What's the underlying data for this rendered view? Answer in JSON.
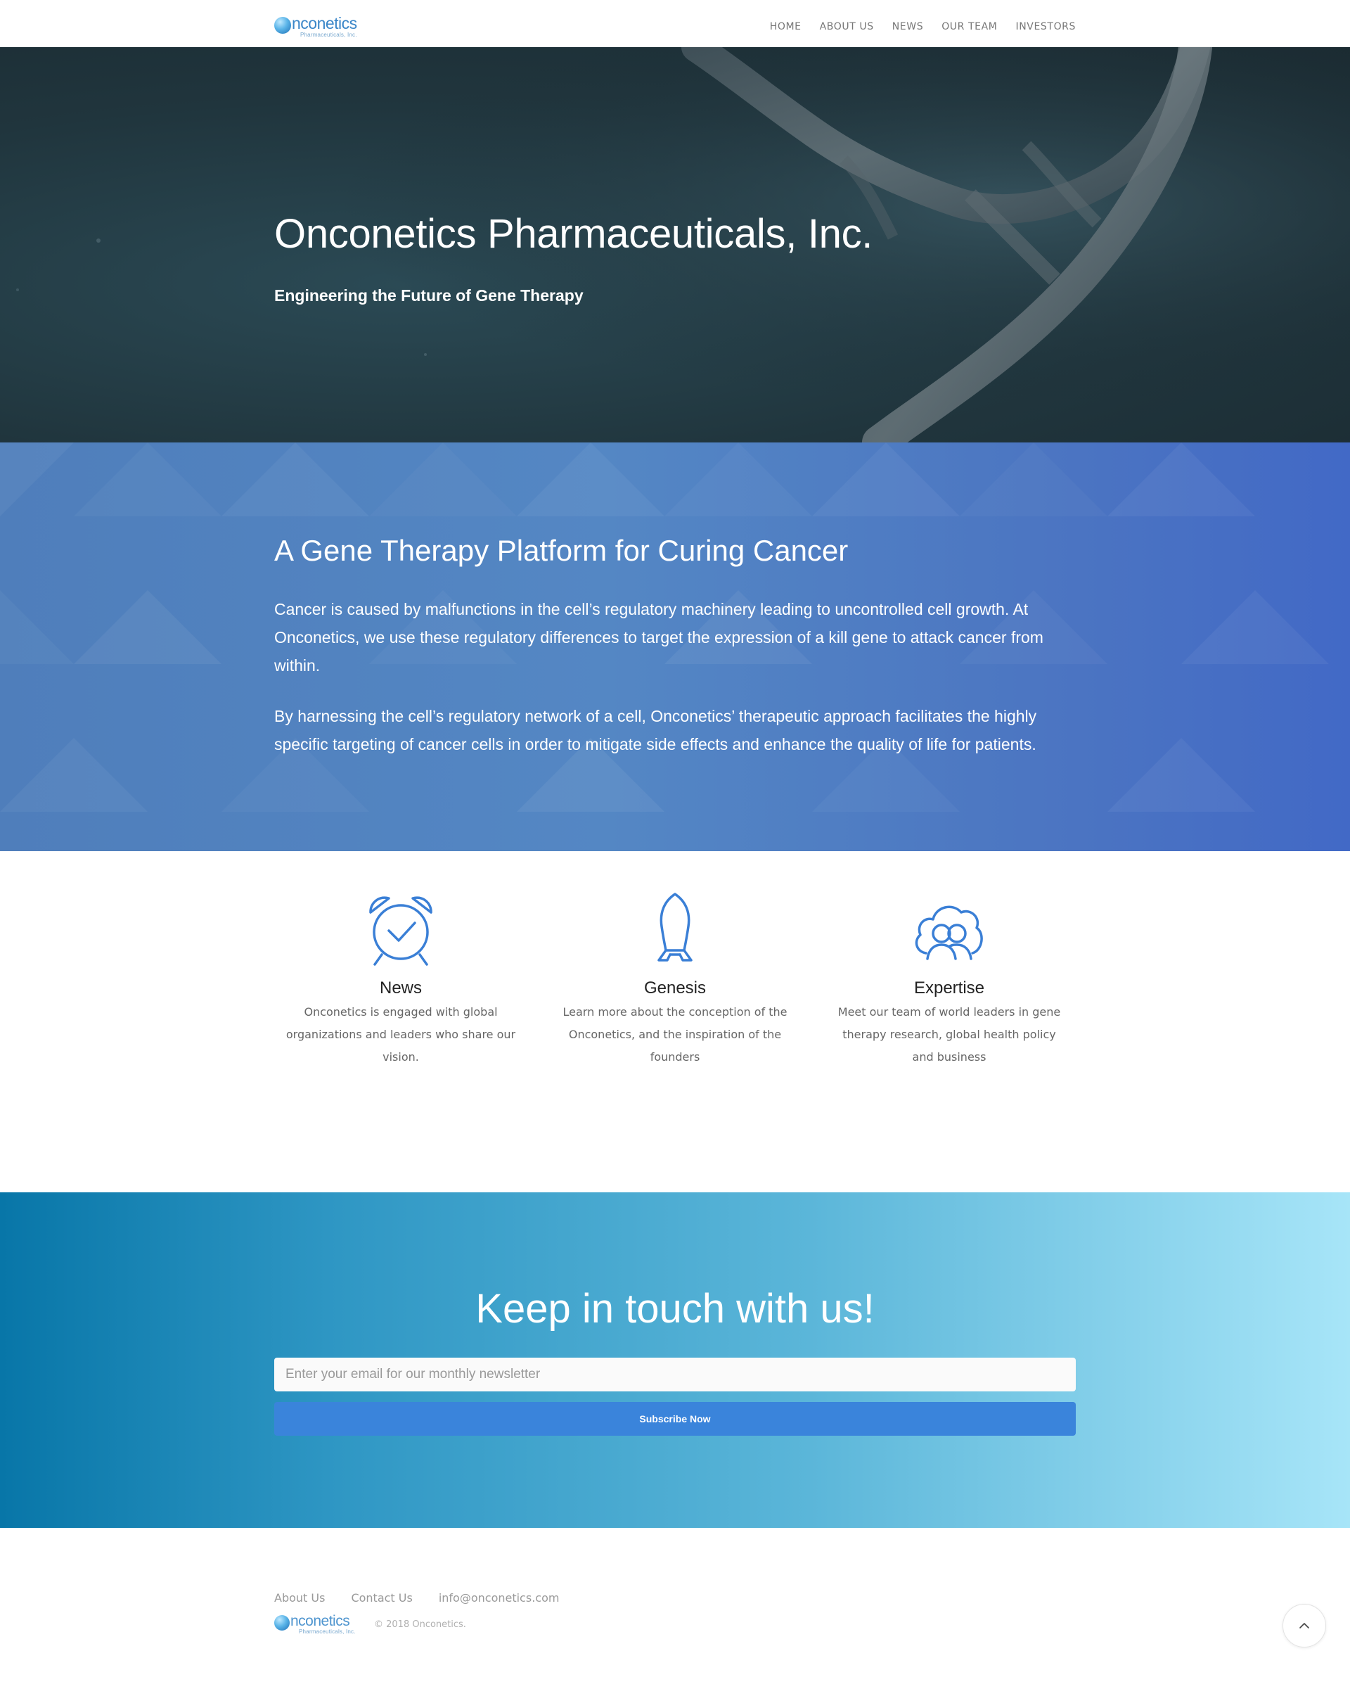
{
  "header": {
    "logo": {
      "name": "nconetics",
      "sub": "Pharmaceuticals, Inc."
    },
    "nav": [
      "HOME",
      "ABOUT US",
      "NEWS",
      "OUR TEAM",
      "INVESTORS"
    ]
  },
  "hero": {
    "title": "Onconetics Pharmaceuticals, Inc.",
    "subtitle": "Engineering the Future of Gene Therapy"
  },
  "platform": {
    "title": "A Gene Therapy Platform for Curing Cancer",
    "paragraph1": "Cancer is caused by malfunctions in the cell’s regulatory machinery leading to uncontrolled cell growth.  At Onconetics, we use these regulatory differences to target the expression of a kill gene to attack cancer from within.",
    "paragraph2": "By harnessing the cell’s regulatory network of a cell, Onconetics’ therapeutic approach facilitates the highly specific targeting of cancer cells in order to mitigate side effects and enhance the quality of life for patients."
  },
  "features": [
    {
      "icon": "alarm-clock-icon",
      "title": "News",
      "description": "Onconetics is engaged with global organizations and leaders who share our vision."
    },
    {
      "icon": "rocket-icon",
      "title": "Genesis",
      "description": "Learn more about the conception of the Onconetics, and the inspiration of the founders"
    },
    {
      "icon": "team-icon",
      "title": "Expertise",
      "description": "Meet our team of world leaders in gene therapy research, global health policy and business"
    }
  ],
  "newsletter": {
    "title": "Keep in touch with us!",
    "email_placeholder": "Enter your email for our monthly newsletter",
    "email_value": "",
    "button_label": "Subscribe Now"
  },
  "footer": {
    "links": [
      "About Us",
      "Contact Us",
      "info@onconetics.com"
    ],
    "logo": {
      "name": "nconetics",
      "sub": "Pharmaceuticals, Inc."
    },
    "copyright": "© 2018 Onconetics."
  },
  "colors": {
    "accent": "#3a84db",
    "icon_blue": "#3a7fd6",
    "hero_bg": "#20353d",
    "platform_bg": "#5083c2"
  }
}
